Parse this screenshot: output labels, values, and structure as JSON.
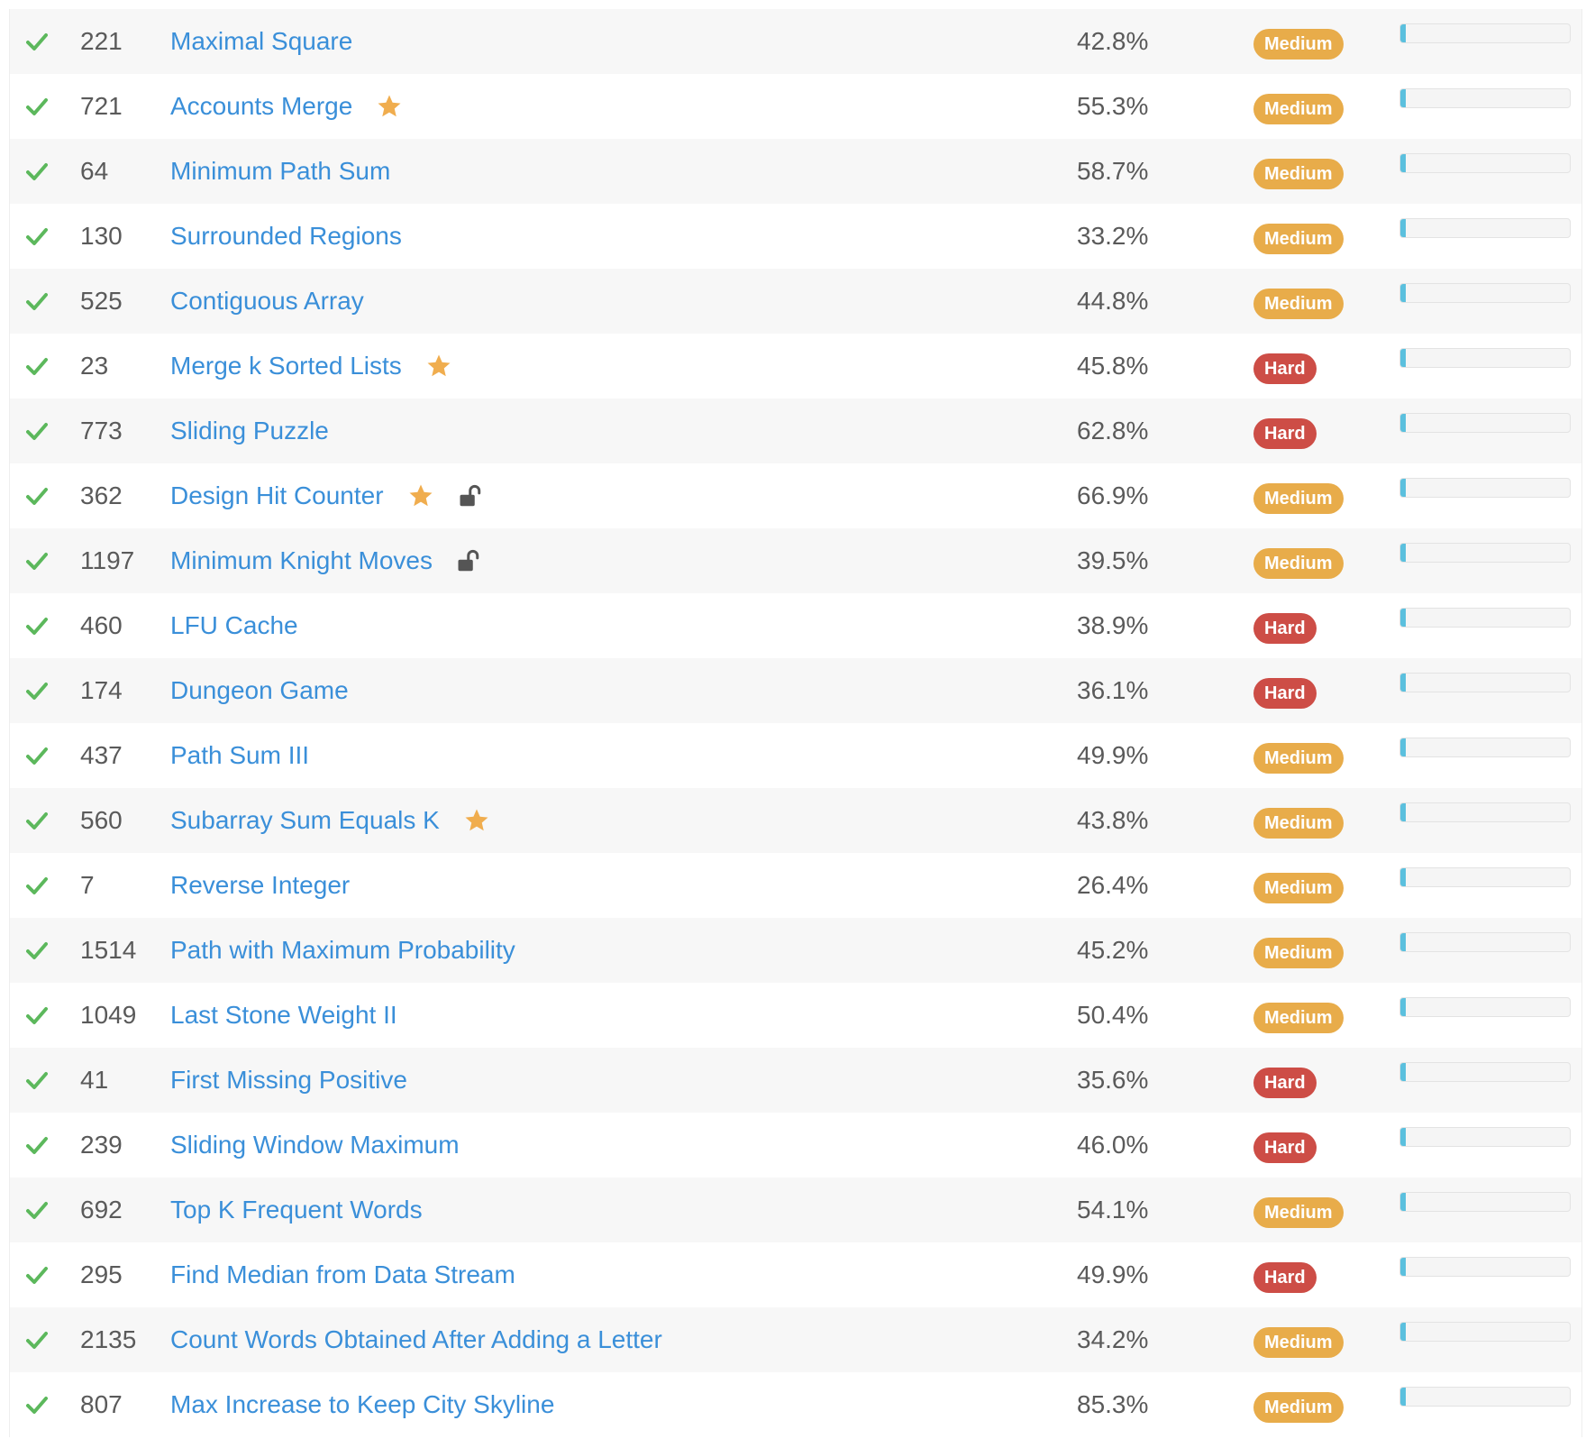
{
  "colors": {
    "link": "#3a8fd9",
    "solved_check": "#5cb85c",
    "medium": "#e8ac4a",
    "hard": "#cd4d46",
    "star": "#f0ad4e",
    "frequency_fill": "#5bc0de"
  },
  "problems": [
    {
      "status_icon": "check-icon",
      "id": "221",
      "title": "Maximal Square",
      "starred": false,
      "locked": false,
      "acceptance": "42.8%",
      "difficulty": "Medium",
      "frequency": 0.03
    },
    {
      "status_icon": "check-icon",
      "id": "721",
      "title": "Accounts Merge",
      "starred": true,
      "locked": false,
      "acceptance": "55.3%",
      "difficulty": "Medium",
      "frequency": 0.03
    },
    {
      "status_icon": "check-icon",
      "id": "64",
      "title": "Minimum Path Sum",
      "starred": false,
      "locked": false,
      "acceptance": "58.7%",
      "difficulty": "Medium",
      "frequency": 0.03
    },
    {
      "status_icon": "check-icon",
      "id": "130",
      "title": "Surrounded Regions",
      "starred": false,
      "locked": false,
      "acceptance": "33.2%",
      "difficulty": "Medium",
      "frequency": 0.03
    },
    {
      "status_icon": "check-icon",
      "id": "525",
      "title": "Contiguous Array",
      "starred": false,
      "locked": false,
      "acceptance": "44.8%",
      "difficulty": "Medium",
      "frequency": 0.03
    },
    {
      "status_icon": "check-icon",
      "id": "23",
      "title": "Merge k Sorted Lists",
      "starred": true,
      "locked": false,
      "acceptance": "45.8%",
      "difficulty": "Hard",
      "frequency": 0.03
    },
    {
      "status_icon": "check-icon",
      "id": "773",
      "title": "Sliding Puzzle",
      "starred": false,
      "locked": false,
      "acceptance": "62.8%",
      "difficulty": "Hard",
      "frequency": 0.03
    },
    {
      "status_icon": "check-icon",
      "id": "362",
      "title": "Design Hit Counter",
      "starred": true,
      "locked": true,
      "acceptance": "66.9%",
      "difficulty": "Medium",
      "frequency": 0.03
    },
    {
      "status_icon": "check-icon",
      "id": "1197",
      "title": "Minimum Knight Moves",
      "starred": false,
      "locked": true,
      "acceptance": "39.5%",
      "difficulty": "Medium",
      "frequency": 0.03
    },
    {
      "status_icon": "check-icon",
      "id": "460",
      "title": "LFU Cache",
      "starred": false,
      "locked": false,
      "acceptance": "38.9%",
      "difficulty": "Hard",
      "frequency": 0.03
    },
    {
      "status_icon": "check-icon",
      "id": "174",
      "title": "Dungeon Game",
      "starred": false,
      "locked": false,
      "acceptance": "36.1%",
      "difficulty": "Hard",
      "frequency": 0.03
    },
    {
      "status_icon": "check-icon",
      "id": "437",
      "title": "Path Sum III",
      "starred": false,
      "locked": false,
      "acceptance": "49.9%",
      "difficulty": "Medium",
      "frequency": 0.03
    },
    {
      "status_icon": "check-icon",
      "id": "560",
      "title": "Subarray Sum Equals K",
      "starred": true,
      "locked": false,
      "acceptance": "43.8%",
      "difficulty": "Medium",
      "frequency": 0.03
    },
    {
      "status_icon": "check-icon",
      "id": "7",
      "title": "Reverse Integer",
      "starred": false,
      "locked": false,
      "acceptance": "26.4%",
      "difficulty": "Medium",
      "frequency": 0.03
    },
    {
      "status_icon": "check-icon",
      "id": "1514",
      "title": "Path with Maximum Probability",
      "starred": false,
      "locked": false,
      "acceptance": "45.2%",
      "difficulty": "Medium",
      "frequency": 0.03
    },
    {
      "status_icon": "check-icon",
      "id": "1049",
      "title": "Last Stone Weight II",
      "starred": false,
      "locked": false,
      "acceptance": "50.4%",
      "difficulty": "Medium",
      "frequency": 0.03
    },
    {
      "status_icon": "check-icon",
      "id": "41",
      "title": "First Missing Positive",
      "starred": false,
      "locked": false,
      "acceptance": "35.6%",
      "difficulty": "Hard",
      "frequency": 0.03
    },
    {
      "status_icon": "check-icon",
      "id": "239",
      "title": "Sliding Window Maximum",
      "starred": false,
      "locked": false,
      "acceptance": "46.0%",
      "difficulty": "Hard",
      "frequency": 0.03
    },
    {
      "status_icon": "check-icon",
      "id": "692",
      "title": "Top K Frequent Words",
      "starred": false,
      "locked": false,
      "acceptance": "54.1%",
      "difficulty": "Medium",
      "frequency": 0.03
    },
    {
      "status_icon": "check-icon",
      "id": "295",
      "title": "Find Median from Data Stream",
      "starred": false,
      "locked": false,
      "acceptance": "49.9%",
      "difficulty": "Hard",
      "frequency": 0.03
    },
    {
      "status_icon": "check-icon",
      "id": "2135",
      "title": "Count Words Obtained After Adding a Letter",
      "starred": false,
      "locked": false,
      "acceptance": "34.2%",
      "difficulty": "Medium",
      "frequency": 0.03
    },
    {
      "status_icon": "check-icon",
      "id": "807",
      "title": "Max Increase to Keep City Skyline",
      "starred": false,
      "locked": false,
      "acceptance": "85.3%",
      "difficulty": "Medium",
      "frequency": 0.03
    }
  ]
}
